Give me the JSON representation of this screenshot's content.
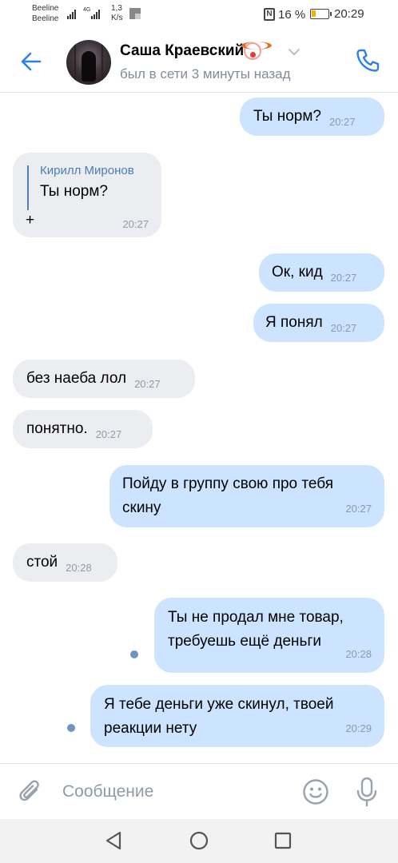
{
  "status_bar": {
    "carrier1": "Beeline",
    "carrier2": "Beeline",
    "network": "4G",
    "speed_value": "1,3",
    "speed_unit": "K/s",
    "battery": "16 %",
    "time": "20:29"
  },
  "header": {
    "contact_name": "Саша Краевский",
    "status": "был в сети 3 минуты назад",
    "back_icon": "arrow-left-icon",
    "call_icon": "phone-icon",
    "accent_color": "#2d81e0"
  },
  "messages": [
    {
      "side": "out",
      "text": "Ты норм?",
      "time": "20:27"
    },
    {
      "side": "in",
      "reply_author": "Кирилл Миронов",
      "reply_text": "Ты норм?",
      "text": "+",
      "time": "20:27"
    },
    {
      "side": "out",
      "text": "Ок, кид",
      "time": "20:27"
    },
    {
      "side": "out",
      "text": "Я понял",
      "time": "20:27"
    },
    {
      "side": "in",
      "text": "без наеба лол",
      "time": "20:27"
    },
    {
      "side": "in",
      "text": "понятно.",
      "time": "20:27"
    },
    {
      "side": "out",
      "text_line1": "Пойду в группу свою про тебя",
      "text_line2": "скину",
      "time": "20:27"
    },
    {
      "side": "in",
      "text": "стой",
      "time": "20:28"
    },
    {
      "side": "out",
      "unread": true,
      "text_line1": "Ты не продал мне товар,",
      "text_line2": "требуешь ещё деньги",
      "time": "20:28"
    },
    {
      "side": "out",
      "unread": true,
      "text_line1": "Я тебе деньги уже скинул, твоей",
      "text_line2": "реакции нету",
      "time": "20:29"
    }
  ],
  "composer": {
    "placeholder": "Сообщение",
    "attach_icon": "paperclip-icon",
    "emoji_icon": "smiley-icon",
    "mic_icon": "microphone-icon"
  },
  "colors": {
    "incoming_bubble": "#ebedf0",
    "outgoing_bubble": "#cce4ff",
    "icon_accent": "#2d81e0"
  }
}
